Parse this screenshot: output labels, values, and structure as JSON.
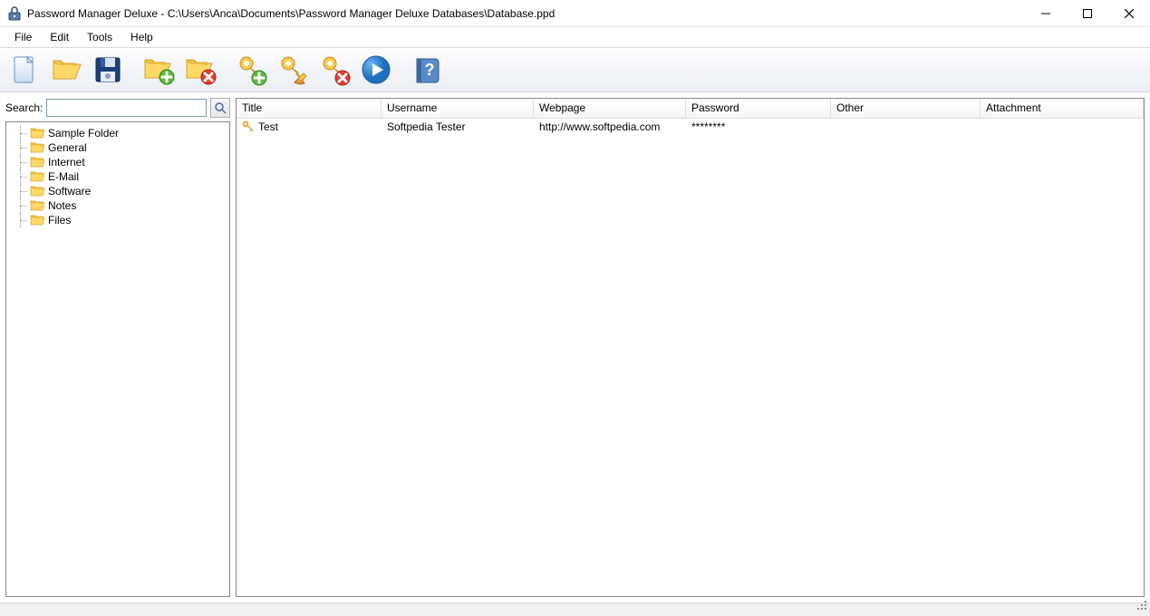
{
  "window": {
    "title": "Password Manager Deluxe - C:\\Users\\Anca\\Documents\\Password Manager Deluxe Databases\\Database.ppd"
  },
  "menu": {
    "file": "File",
    "edit": "Edit",
    "tools": "Tools",
    "help": "Help"
  },
  "toolbar": {
    "new": "new-file-icon",
    "open": "open-folder-icon",
    "save": "save-floppy-icon",
    "add_folder": "folder-add-icon",
    "delete_folder": "folder-delete-icon",
    "add_key": "key-add-icon",
    "edit_key": "key-edit-icon",
    "delete_key": "key-delete-icon",
    "play": "play-icon",
    "help": "help-book-icon"
  },
  "search": {
    "label": "Search:",
    "value": ""
  },
  "tree": {
    "items": [
      {
        "label": "Sample Folder"
      },
      {
        "label": "General"
      },
      {
        "label": "Internet"
      },
      {
        "label": "E-Mail"
      },
      {
        "label": "Software"
      },
      {
        "label": "Notes"
      },
      {
        "label": "Files"
      }
    ]
  },
  "grid": {
    "headers": {
      "title": "Title",
      "username": "Username",
      "webpage": "Webpage",
      "password": "Password",
      "other": "Other",
      "attachment": "Attachment"
    },
    "rows": [
      {
        "title": "Test",
        "username": "Softpedia Tester",
        "webpage": "http://www.softpedia.com",
        "password": "********",
        "other": "",
        "attachment": ""
      }
    ]
  }
}
